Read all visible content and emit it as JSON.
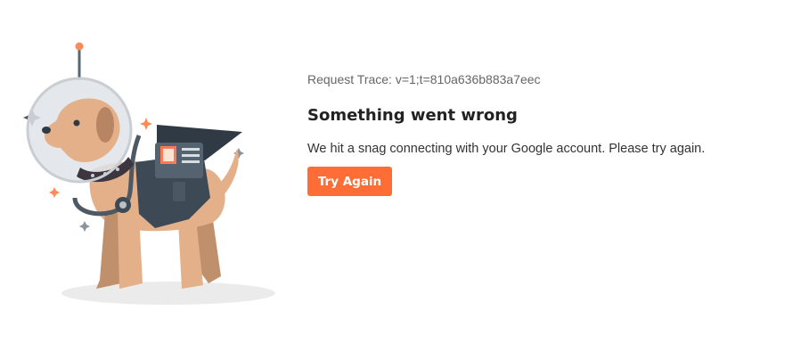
{
  "error": {
    "request_trace": "Request Trace: v=1;t=810a636b883a7eec",
    "title": "Something went wrong",
    "message": "We hit a snag connecting with your Google account. Please try again.",
    "retry_label": "Try Again"
  },
  "colors": {
    "accent": "#ff6d37",
    "title_text": "#222222",
    "body_text": "#333333",
    "muted_text": "#666666"
  },
  "illustration": {
    "icon": "astronaut-dog-icon"
  }
}
